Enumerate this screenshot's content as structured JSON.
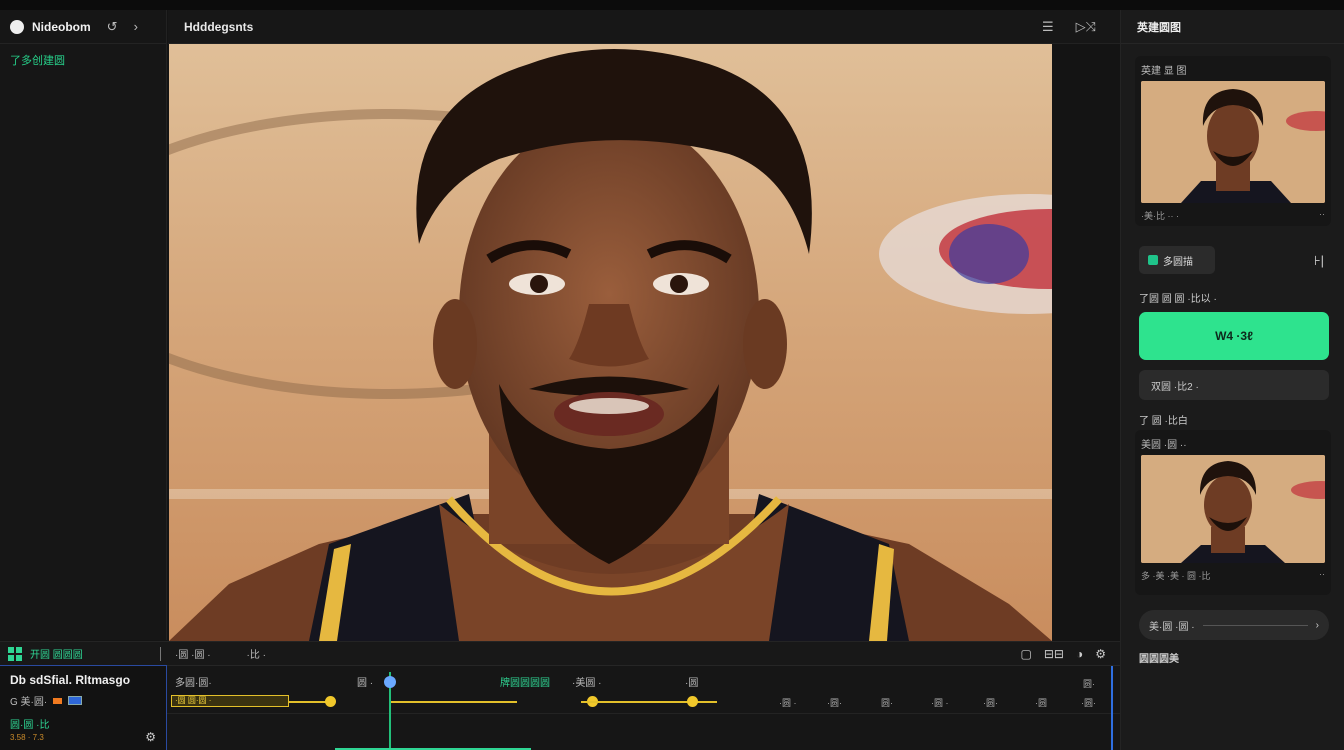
{
  "app": {
    "title": "Nideobom",
    "project_name": "Hdddegsnts"
  },
  "left_panel": {
    "subtitle": "了多创建圆"
  },
  "right_panel": {
    "title": "英建圆图",
    "card1": {
      "label": "英建 显 图",
      "foot_left": "·美·比 ·· ·",
      "foot_right": "··"
    },
    "small_button_label": "多圆描",
    "corner_icon_text": "⊦|",
    "section1_label": "了圆 圆 圆 ·比以 ·",
    "primary_button_label": "W4 ·3ℓ",
    "secondary_button_label": "双圆 ·比2 ·",
    "section2_label": "了 圆 ·比白",
    "card2": {
      "label": "美圆 ·圆 ··",
      "foot_left": "多 ·美 ·美 · 圆 ·比",
      "foot_right": "··"
    },
    "row_label": "美·圆 ·圆 ·",
    "footer_label": "圆圆圆美"
  },
  "bottom_bar": {
    "left_label": "开圆 圆圆圆",
    "tab1": "·圆 ·圆 ·",
    "tab2": "·比 ·"
  },
  "info_panel": {
    "title": "Db sdSfial. Rltmasgo",
    "row1_label": "G 美·圆·",
    "green_label": "圆·圆 ·比",
    "small_text": "3.58 · 7.3"
  },
  "timeline": {
    "labels": [
      "多圆·圆·",
      "圆 ·",
      "牌圆圆圆圆",
      "·美圆 ·",
      "·圆"
    ],
    "clip_label": "·圆 圆·圆 ·",
    "tick_labels": [
      "·圆 ·",
      "·圆·",
      "圆·",
      "·圆 ·",
      "·圆·",
      "·圆",
      "·圆·",
      "圆·"
    ]
  },
  "colors": {
    "accent": "#2ee38e",
    "timeline_clip": "#e3c02a",
    "selection_blue": "#2f6fe0"
  },
  "icons": [
    "logo-icon",
    "undo-icon",
    "forward-icon",
    "layers-icon",
    "export-icon",
    "grid-icon",
    "square-icon",
    "split-icon",
    "color-icon",
    "settings-icon",
    "chevron-right-icon"
  ]
}
